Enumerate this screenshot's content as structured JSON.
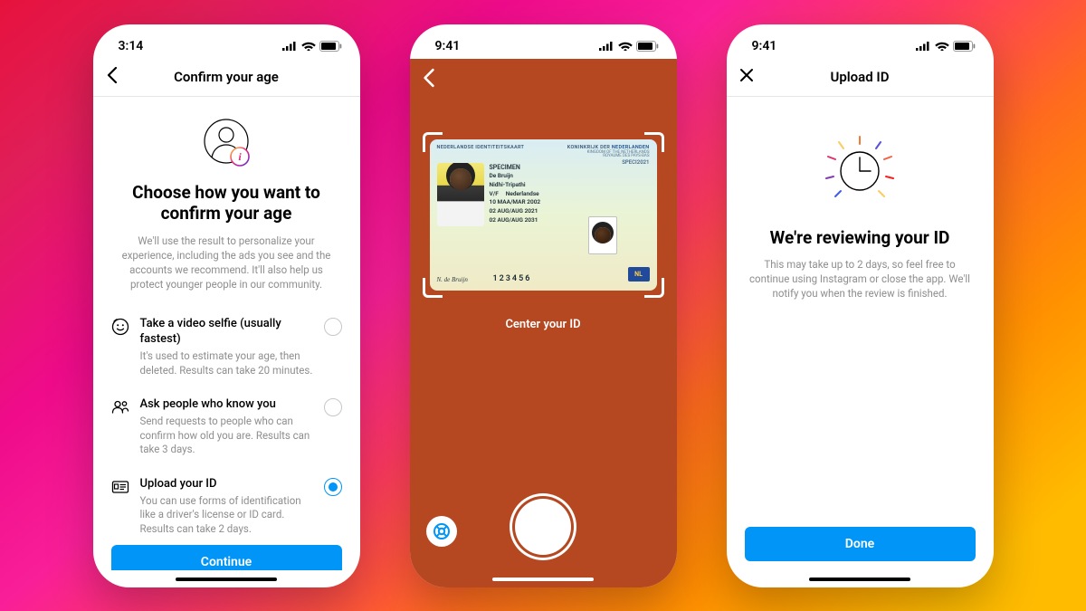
{
  "status": {
    "time_left": "3:14",
    "time_mid": "9:41",
    "time_right": "9:41"
  },
  "screen1": {
    "nav_title": "Confirm your age",
    "heading": "Choose how you want to confirm your age",
    "subtext": "We'll use the result to personalize your experience, including the ads you see and the accounts we recommend. It'll also help us protect younger people in our community.",
    "options": [
      {
        "title": "Take a video selfie (usually fastest)",
        "desc": "It's used to estimate your age, then deleted. Results can take 20 minutes."
      },
      {
        "title": "Ask people who know you",
        "desc": "Send requests to people who can confirm how old you are. Results can take 3 days."
      },
      {
        "title": "Upload your ID",
        "desc": "You can use forms of identification like a driver's license or ID card. Results can take 2 days."
      }
    ],
    "button": "Continue"
  },
  "screen2": {
    "center_label": "Center your ID",
    "id": {
      "header_left": "NEDERLANDSE IDENTITEITSKAART",
      "header_right_pre": "KONINKRIJK DER",
      "header_right_nl": "NEDERLANDEN",
      "sub_right1": "KINGDOM OF THE NETHERLANDS",
      "sub_right2": "ROYAUME DES PAYS-BAS",
      "specimen": "SPECIMEN",
      "speci": "SPECI2021",
      "surname": "De Bruijn",
      "given": "Nidhi-Tripathi",
      "sex": "V/F",
      "nat": "Nederlandse",
      "dob": "10 MAA/MAR 2002",
      "issue": "02 AUG/AUG 2021",
      "expiry": "02 AUG/AUG 2031",
      "docnum": "123456",
      "signature": "N. de Bruijn"
    }
  },
  "screen3": {
    "nav_title": "Upload ID",
    "heading": "We're reviewing your ID",
    "subtext": "This may take up to 2 days, so feel free to continue using Instagram or close the app. We'll notify you when the review is finished.",
    "button": "Done"
  }
}
